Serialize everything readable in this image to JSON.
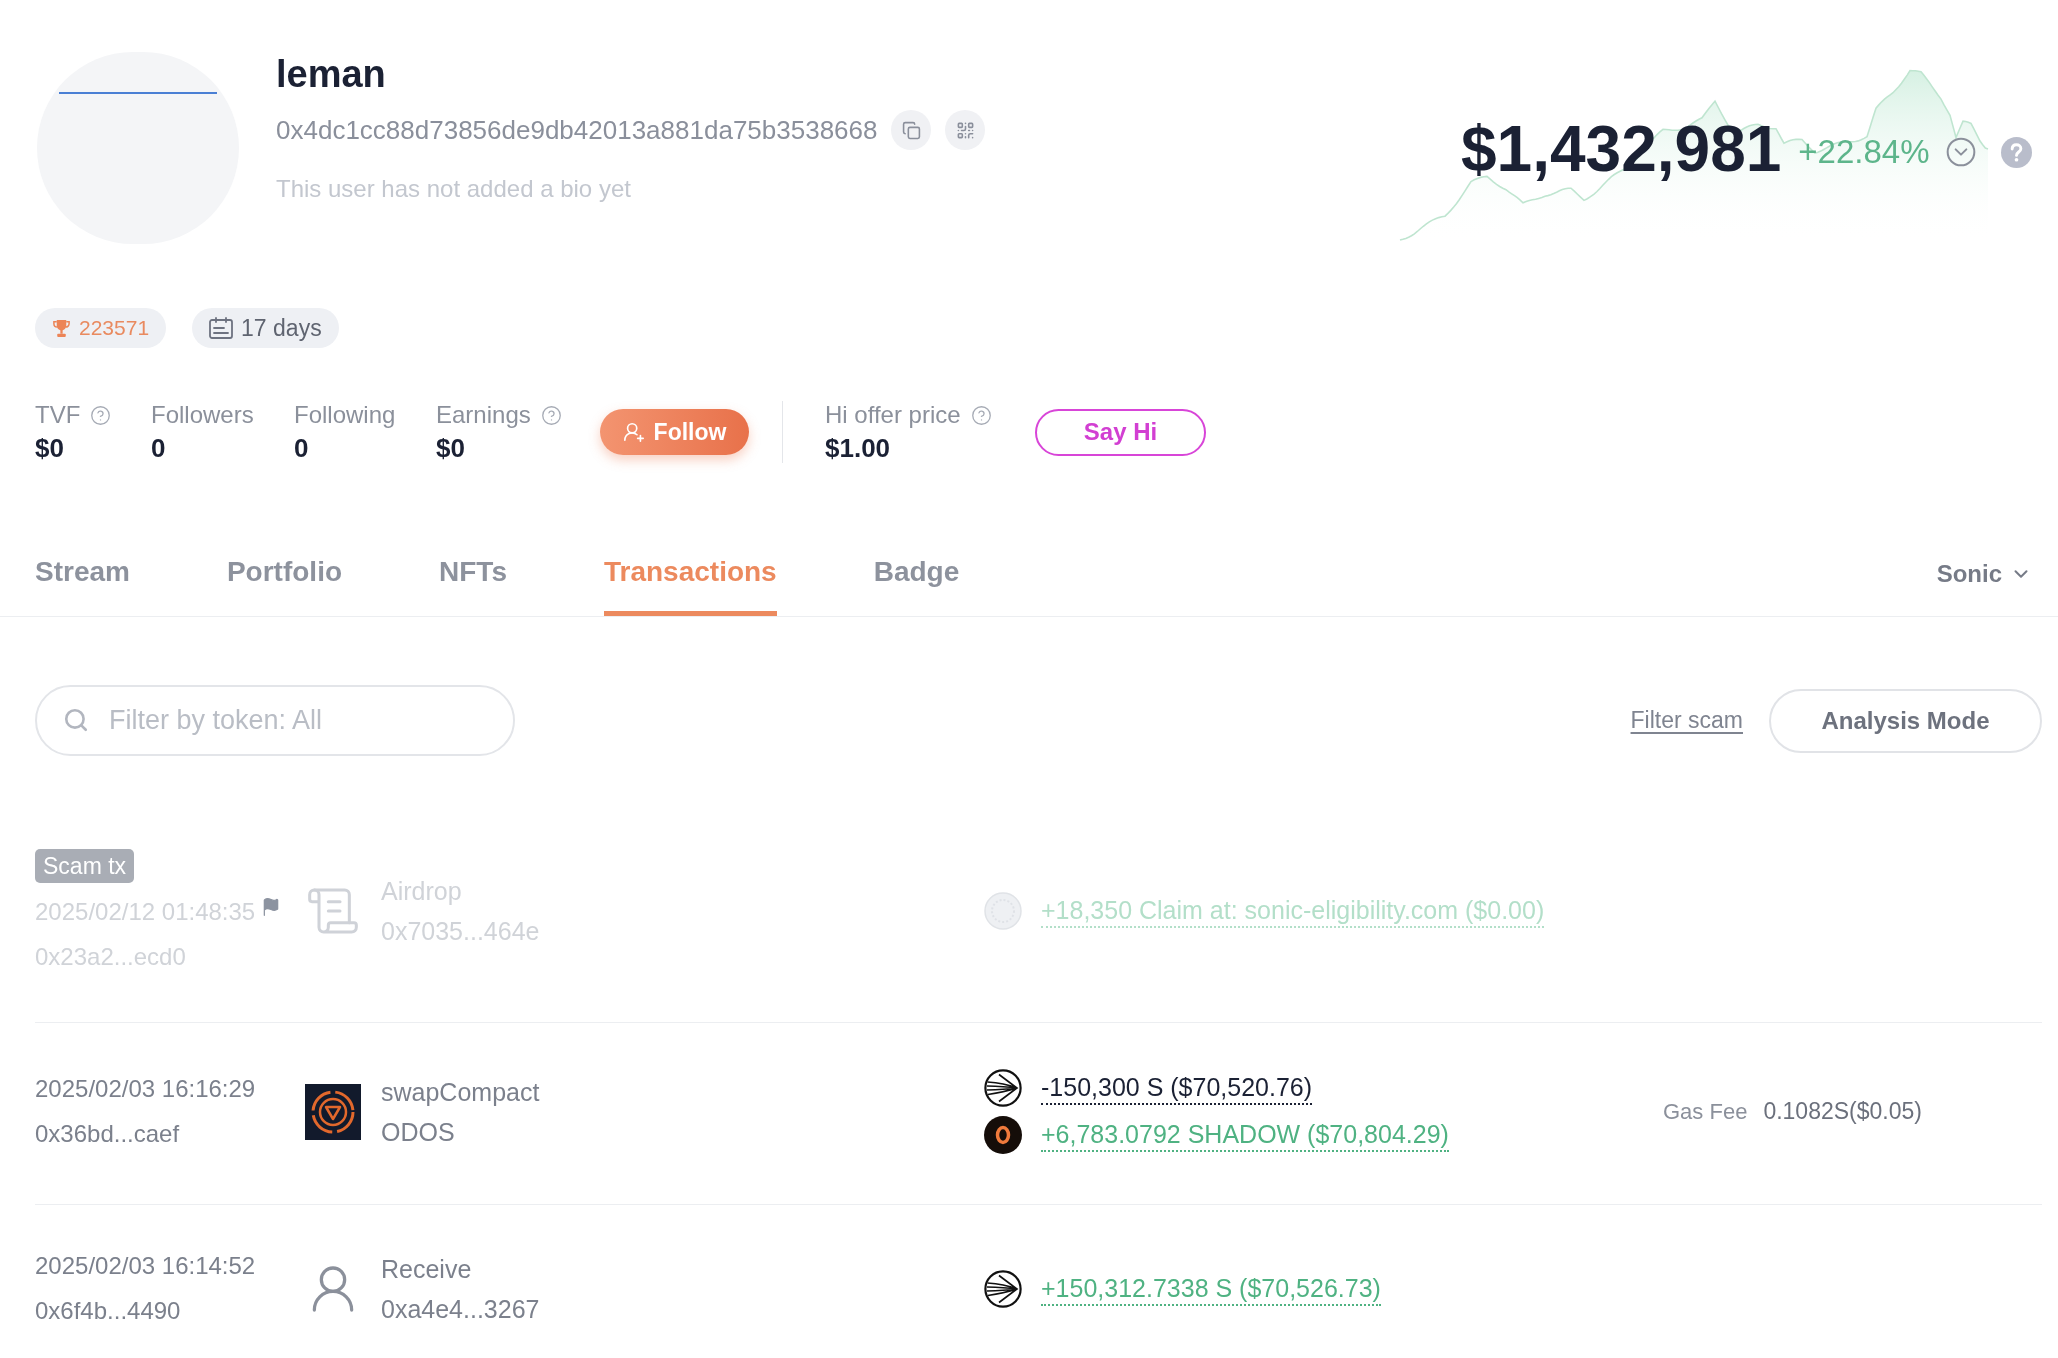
{
  "profile": {
    "name": "leman",
    "address": "0x4dc1cc88d73856de9db42013a881da75b3538668",
    "bio": "This user has not added a bio yet"
  },
  "portfolio": {
    "value": "$1,432,981",
    "change": "+22.84%"
  },
  "badges": [
    {
      "kind": "rank",
      "text": "223571"
    },
    {
      "kind": "age",
      "text": "17 days"
    }
  ],
  "stats": [
    {
      "label": "TVF",
      "value": "$0",
      "help": true
    },
    {
      "label": "Followers",
      "value": "0",
      "help": false
    },
    {
      "label": "Following",
      "value": "0",
      "help": false
    },
    {
      "label": "Earnings",
      "value": "$0",
      "help": true
    }
  ],
  "follow_button": {
    "label": "Follow"
  },
  "offer": {
    "label": "Hi offer price",
    "value": "$1.00",
    "help": true
  },
  "say_hi_button": {
    "label": "Say Hi"
  },
  "tabs": [
    {
      "label": "Stream",
      "selected": false
    },
    {
      "label": "Portfolio",
      "selected": false
    },
    {
      "label": "NFTs",
      "selected": false
    },
    {
      "label": "Transactions",
      "selected": true
    },
    {
      "label": "Badge",
      "selected": false
    }
  ],
  "chain_selector": {
    "value": "Sonic"
  },
  "filter": {
    "placeholder": "Filter by token: All"
  },
  "filter_scam_link": "Filter scam",
  "analysis_mode_button": "Analysis Mode",
  "transactions": [
    {
      "scam": true,
      "badge": "Scam tx",
      "time": "2025/02/12 01:48:35",
      "hash": "0x23a2...ecd0",
      "kind": "document",
      "method": "Airdrop",
      "counterparty": "0x7035...464e",
      "transfers": [
        {
          "kind": "unknown",
          "outgoing": false,
          "amount": "+18,350 Claim at: sonic-eligibility.com ($0.00)"
        }
      ]
    },
    {
      "scam": false,
      "time": "2025/02/03 16:16:29",
      "hash": "0x36bd...caef",
      "kind": "app",
      "method": "swapCompact",
      "counterparty": "ODOS",
      "transfers": [
        {
          "kind": "sonic",
          "outgoing": true,
          "amount": "-150,300 S ($70,520.76)"
        },
        {
          "kind": "shadow",
          "outgoing": false,
          "amount": "+6,783.0792 SHADOW ($70,804.29)"
        }
      ],
      "gas_fee": {
        "label": "Gas Fee",
        "value": "0.1082S($0.05)"
      }
    },
    {
      "scam": false,
      "time": "2025/02/03 16:14:52",
      "hash": "0x6f4b...4490",
      "kind": "person",
      "method": "Receive",
      "counterparty": "0xa4e4...3267",
      "transfers": [
        {
          "kind": "sonic",
          "outgoing": false,
          "amount": "+150,312.7338 S ($70,526.73)"
        }
      ]
    }
  ]
}
